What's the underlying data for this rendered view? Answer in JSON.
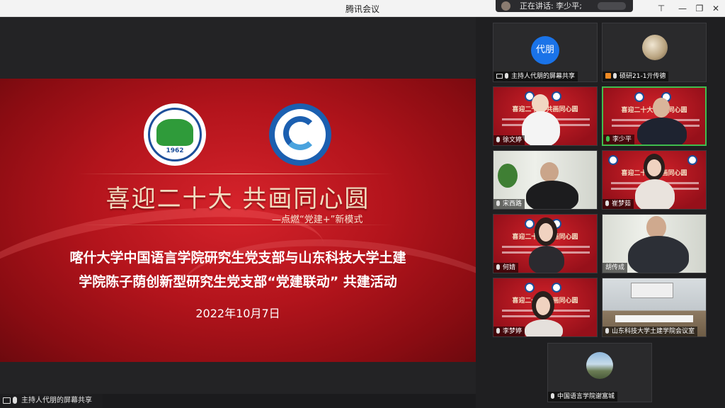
{
  "window": {
    "title": "腾讯会议",
    "speaking_label": "正在讲话: 李少平;"
  },
  "slide": {
    "headline": "喜迎二十大 共画同心圆",
    "subhead": "—点燃“党建+”新模式",
    "line1": "喀什大学中国语言学院研究生党支部与山东科技大学土建",
    "line2": "学院陈子荫创新型研究生党支部“党建联动” 共建活动",
    "date": "2022年10月7日",
    "logo1_year": "1962"
  },
  "share_status": "主持人代朋的屏幕共享",
  "participants": [
    {
      "name": "主持人代朋的屏幕共享",
      "avatar_text": "代朋"
    },
    {
      "name": "硕研21-1亓传德"
    },
    {
      "name": "徐文婷"
    },
    {
      "name": "李少平"
    },
    {
      "name": "宋西路"
    },
    {
      "name": "崔梦茹"
    },
    {
      "name": "何婧"
    },
    {
      "name": "胡传成"
    },
    {
      "name": "李梦婷"
    },
    {
      "name": "山东科技大学土建学院会议室"
    },
    {
      "name": "中国语言学院谢富城"
    }
  ],
  "mini_slide_title": "喜迎二十大 共画同心圆",
  "colors": {
    "accent_green": "#3fbd4e",
    "avatar_blue": "#1a73e8",
    "slide_red": "#c41a22"
  }
}
